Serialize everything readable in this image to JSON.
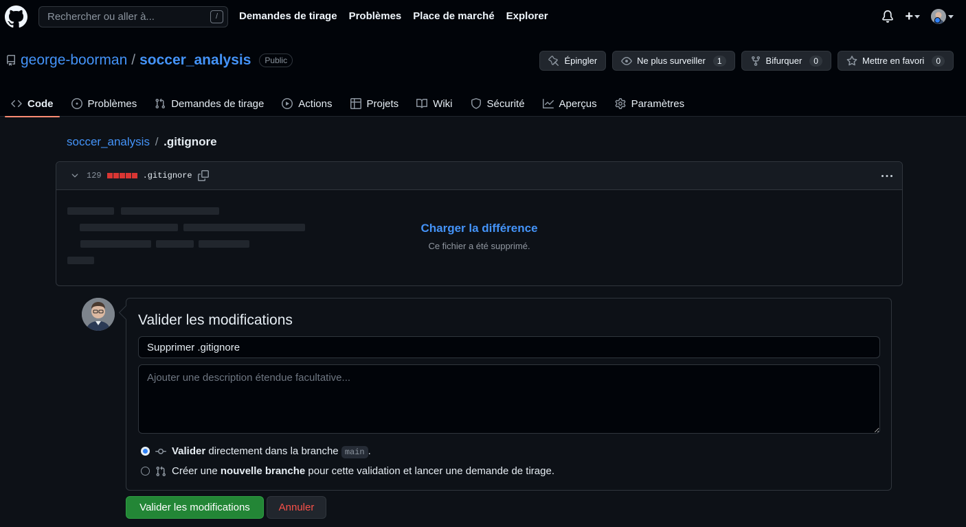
{
  "header": {
    "search_placeholder": "Rechercher ou aller à...",
    "search_shortcut": "/",
    "nav": [
      "Demandes de tirage",
      "Problèmes",
      "Place de marché",
      "Explorer"
    ],
    "plus_label": "+"
  },
  "repo": {
    "owner": "george-boorman",
    "separator": "/",
    "name": "soccer_analysis",
    "visibility": "Public",
    "actions": {
      "pin": "Épingler",
      "unwatch": "Ne plus surveiller",
      "unwatch_count": "1",
      "fork": "Bifurquer",
      "fork_count": "0",
      "star": "Mettre en favori",
      "star_count": "0"
    },
    "tabs": [
      "Code",
      "Problèmes",
      "Demandes de tirage",
      "Actions",
      "Projets",
      "Wiki",
      "Sécurité",
      "Aperçus",
      "Paramètres"
    ]
  },
  "breadcrumb": {
    "root": "soccer_analysis",
    "separator": "/",
    "file": ".gitignore"
  },
  "diff": {
    "deletions": "129",
    "filename": ".gitignore",
    "load_link": "Charger la différence",
    "note": "Ce fichier a été supprimé."
  },
  "commit": {
    "title": "Valider les modifications",
    "summary_value": "Supprimer .gitignore",
    "description_placeholder": "Ajouter une description étendue facultative...",
    "option_direct": {
      "strong": "Valider",
      "text": " directement dans la branche ",
      "branch": "main",
      "suffix": "."
    },
    "option_new_branch": {
      "prefix": "Créer une ",
      "strong": "nouvelle branche",
      "text": " pour cette validation et lancer une demande de tirage."
    },
    "selected_option": "direct",
    "commit_button": "Valider les modifications",
    "cancel_button": "Annuler"
  },
  "colors": {
    "link": "#4493f8",
    "primary_button": "#238636",
    "danger": "#f85149",
    "deletion": "#da3633",
    "active_tab_underline": "#fd8c73"
  }
}
